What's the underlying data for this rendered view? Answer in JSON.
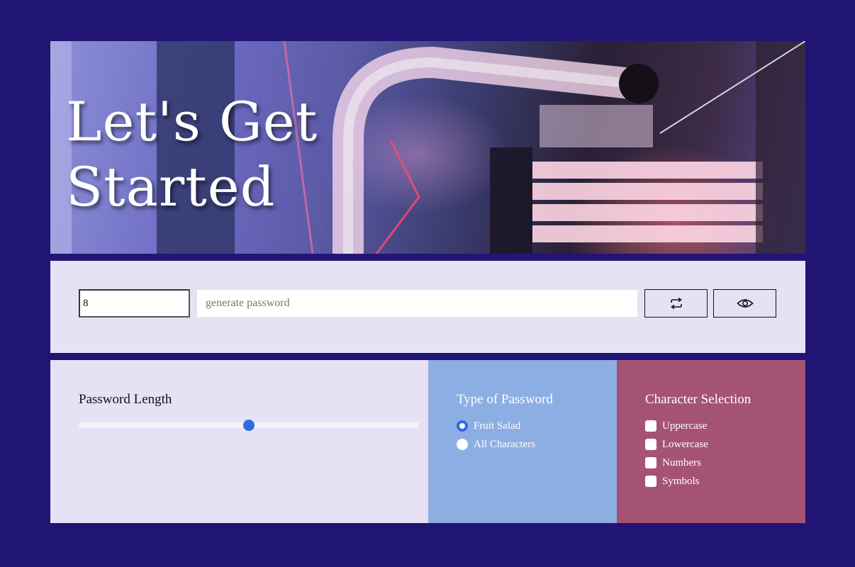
{
  "hero": {
    "title_line1": "Let's Get",
    "title_line2": "Started"
  },
  "controls": {
    "length_value": "8",
    "password_placeholder": "generate password",
    "password_value": "",
    "regenerate_icon": "repeat-icon",
    "toggle_icon": "eye-icon"
  },
  "length_panel": {
    "heading": "Password Length",
    "slider_fraction": 0.5
  },
  "type_panel": {
    "heading": "Type of Password",
    "options": [
      {
        "label": "Fruit Salad",
        "checked": true
      },
      {
        "label": "All Characters",
        "checked": false
      }
    ]
  },
  "chars_panel": {
    "heading": "Character Selection",
    "options": [
      {
        "label": "Uppercase",
        "checked": false
      },
      {
        "label": "Lowercase",
        "checked": false
      },
      {
        "label": "Numbers",
        "checked": false
      },
      {
        "label": "Symbols",
        "checked": false
      }
    ]
  },
  "colors": {
    "background": "#211574",
    "panel_light": "#e6e1f5",
    "panel_blue": "#8daee3",
    "panel_rose": "#a55375",
    "accent": "#2f6be3"
  }
}
